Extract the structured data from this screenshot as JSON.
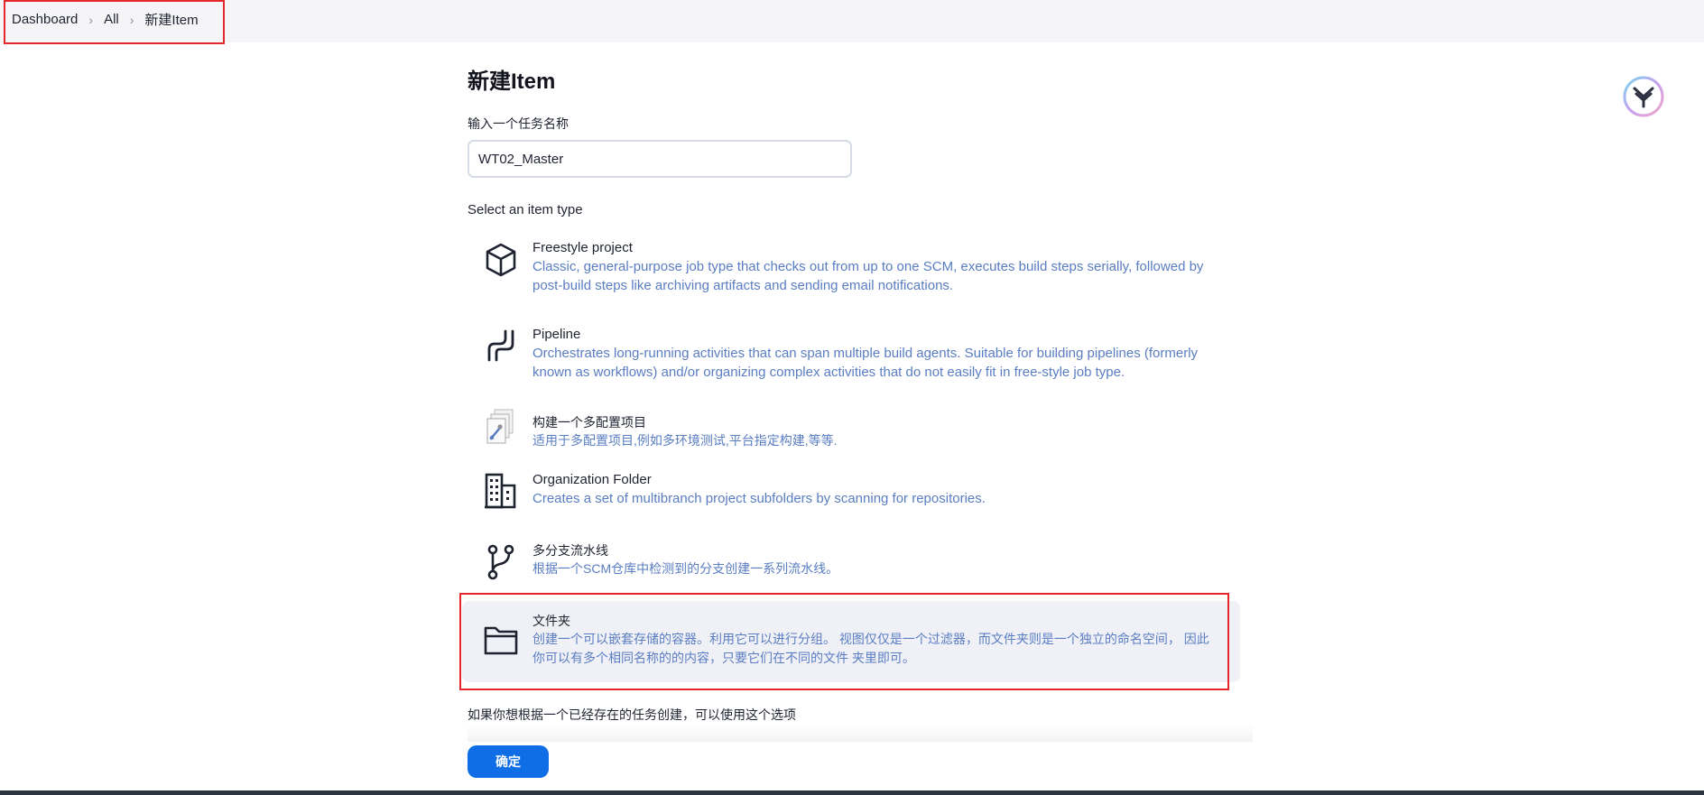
{
  "breadcrumb": {
    "dashboard": "Dashboard",
    "all": "All",
    "current": "新建Item"
  },
  "page": {
    "title": "新建Item",
    "name_label": "输入一个任务名称",
    "name_value": "WT02_Master",
    "type_label": "Select an item type",
    "copy_label": "如果你想根据一个已经存在的任务创建，可以使用这个选项",
    "ok_label": "确定"
  },
  "item_types": [
    {
      "name": "Freestyle project",
      "desc_lines": [
        "Classic, general-purpose job type that checks out from up to one SCM, executes build steps serially, followed by",
        "post-build steps like archiving artifacts and sending email notifications."
      ],
      "icon": "cube-icon"
    },
    {
      "name": "Pipeline",
      "desc_lines": [
        "Orchestrates long-running activities that can span multiple build agents. Suitable for building pipelines (formerly",
        "known as workflows) and/or organizing complex activities that do not easily fit in free-style job type."
      ],
      "icon": "pipeline-icon"
    },
    {
      "name": "构建一个多配置项目",
      "desc_lines": [
        "适用于多配置项目,例如多环境测试,平台指定构建,等等."
      ],
      "icon": "multi-config-icon"
    },
    {
      "name": "Organization Folder",
      "desc_lines": [
        "Creates a set of multibranch project subfolders by scanning for repositories."
      ],
      "icon": "building-icon"
    },
    {
      "name": "多分支流水线",
      "desc_lines": [
        "根据一个SCM仓库中检测到的分支创建一系列流水线。"
      ],
      "icon": "branch-icon"
    },
    {
      "name": "文件夹",
      "desc_lines": [
        "创建一个可以嵌套存储的容器。利用它可以进行分组。 视图仅仅是一个过滤器，而文件夹则是一个独立的命名空间， 因此",
        "你可以有多个相同名称的的内容，只要它们在不同的文件 夹里即可。"
      ],
      "icon": "folder-icon",
      "selected": true
    }
  ],
  "colors": {
    "accent": "#0f6de6",
    "description": "#5a7dc2",
    "highlight": "#e5272c"
  }
}
